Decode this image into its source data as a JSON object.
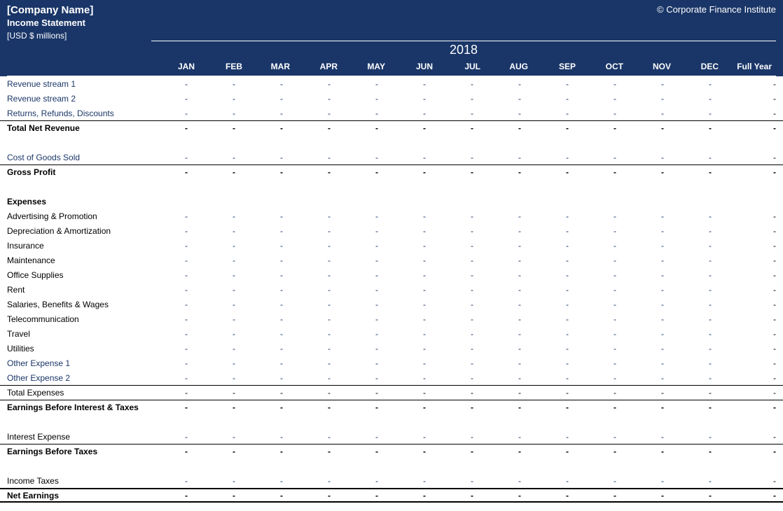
{
  "header": {
    "company_name": "[Company Name]",
    "copyright": "© Corporate Finance Institute",
    "subtitle": "Income Statement",
    "units": "[USD $ millions]",
    "year": "2018",
    "months": [
      "JAN",
      "FEB",
      "MAR",
      "APR",
      "MAY",
      "JUN",
      "JUL",
      "AUG",
      "SEP",
      "OCT",
      "NOV",
      "DEC",
      "Full Year"
    ]
  },
  "rows": [
    {
      "type": "data",
      "label": "Revenue stream 1",
      "labelClass": "input-text",
      "cellClass": "input-val",
      "values": [
        "-",
        "-",
        "-",
        "-",
        "-",
        "-",
        "-",
        "-",
        "-",
        "-",
        "-",
        "-",
        "-"
      ]
    },
    {
      "type": "data",
      "label": "Revenue stream 2",
      "labelClass": "input-text",
      "cellClass": "input-val",
      "values": [
        "-",
        "-",
        "-",
        "-",
        "-",
        "-",
        "-",
        "-",
        "-",
        "-",
        "-",
        "-",
        "-"
      ]
    },
    {
      "type": "data",
      "label": "Returns, Refunds, Discounts",
      "labelClass": "input-text",
      "cellClass": "input-val",
      "values": [
        "-",
        "-",
        "-",
        "-",
        "-",
        "-",
        "-",
        "-",
        "-",
        "-",
        "-",
        "-",
        "-"
      ]
    },
    {
      "type": "data",
      "label": "Total Net Revenue",
      "rowClass": "bold border-top-thin",
      "values": [
        "-",
        "-",
        "-",
        "-",
        "-",
        "-",
        "-",
        "-",
        "-",
        "-",
        "-",
        "-",
        "-"
      ]
    },
    {
      "type": "spacer"
    },
    {
      "type": "data",
      "label": "Cost of Goods Sold",
      "labelClass": "input-text",
      "cellClass": "input-val",
      "values": [
        "-",
        "-",
        "-",
        "-",
        "-",
        "-",
        "-",
        "-",
        "-",
        "-",
        "-",
        "-",
        "-"
      ]
    },
    {
      "type": "data",
      "label": "Gross Profit",
      "rowClass": "bold border-top-thin",
      "values": [
        "-",
        "-",
        "-",
        "-",
        "-",
        "-",
        "-",
        "-",
        "-",
        "-",
        "-",
        "-",
        "-"
      ]
    },
    {
      "type": "spacer"
    },
    {
      "type": "section",
      "label": "Expenses",
      "rowClass": "bold"
    },
    {
      "type": "data",
      "label": "Advertising & Promotion",
      "cellClass": "input-val",
      "values": [
        "-",
        "-",
        "-",
        "-",
        "-",
        "-",
        "-",
        "-",
        "-",
        "-",
        "-",
        "-",
        "-"
      ]
    },
    {
      "type": "data",
      "label": "Depreciation & Amortization",
      "cellClass": "input-val",
      "values": [
        "-",
        "-",
        "-",
        "-",
        "-",
        "-",
        "-",
        "-",
        "-",
        "-",
        "-",
        "-",
        "-"
      ]
    },
    {
      "type": "data",
      "label": "Insurance",
      "cellClass": "input-val",
      "values": [
        "-",
        "-",
        "-",
        "-",
        "-",
        "-",
        "-",
        "-",
        "-",
        "-",
        "-",
        "-",
        "-"
      ]
    },
    {
      "type": "data",
      "label": "Maintenance",
      "cellClass": "input-val",
      "values": [
        "-",
        "-",
        "-",
        "-",
        "-",
        "-",
        "-",
        "-",
        "-",
        "-",
        "-",
        "-",
        "-"
      ]
    },
    {
      "type": "data",
      "label": "Office Supplies",
      "cellClass": "input-val",
      "values": [
        "-",
        "-",
        "-",
        "-",
        "-",
        "-",
        "-",
        "-",
        "-",
        "-",
        "-",
        "-",
        "-"
      ]
    },
    {
      "type": "data",
      "label": "Rent",
      "cellClass": "input-val",
      "values": [
        "-",
        "-",
        "-",
        "-",
        "-",
        "-",
        "-",
        "-",
        "-",
        "-",
        "-",
        "-",
        "-"
      ]
    },
    {
      "type": "data",
      "label": "Salaries, Benefits & Wages",
      "cellClass": "input-val",
      "values": [
        "-",
        "-",
        "-",
        "-",
        "-",
        "-",
        "-",
        "-",
        "-",
        "-",
        "-",
        "-",
        "-"
      ]
    },
    {
      "type": "data",
      "label": "Telecommunication",
      "cellClass": "input-val",
      "values": [
        "-",
        "-",
        "-",
        "-",
        "-",
        "-",
        "-",
        "-",
        "-",
        "-",
        "-",
        "-",
        "-"
      ]
    },
    {
      "type": "data",
      "label": "Travel",
      "cellClass": "input-val",
      "values": [
        "-",
        "-",
        "-",
        "-",
        "-",
        "-",
        "-",
        "-",
        "-",
        "-",
        "-",
        "-",
        "-"
      ]
    },
    {
      "type": "data",
      "label": "Utilities",
      "cellClass": "input-val",
      "values": [
        "-",
        "-",
        "-",
        "-",
        "-",
        "-",
        "-",
        "-",
        "-",
        "-",
        "-",
        "-",
        "-"
      ]
    },
    {
      "type": "data",
      "label": "Other Expense 1",
      "labelClass": "input-text",
      "cellClass": "input-val",
      "values": [
        "-",
        "-",
        "-",
        "-",
        "-",
        "-",
        "-",
        "-",
        "-",
        "-",
        "-",
        "-",
        "-"
      ]
    },
    {
      "type": "data",
      "label": "Other Expense 2",
      "labelClass": "input-text",
      "cellClass": "input-val",
      "values": [
        "-",
        "-",
        "-",
        "-",
        "-",
        "-",
        "-",
        "-",
        "-",
        "-",
        "-",
        "-",
        "-"
      ]
    },
    {
      "type": "data",
      "label": "Total Expenses",
      "rowClass": "border-top-thin",
      "values": [
        "-",
        "-",
        "-",
        "-",
        "-",
        "-",
        "-",
        "-",
        "-",
        "-",
        "-",
        "-",
        "-"
      ]
    },
    {
      "type": "data",
      "label": "Earnings Before Interest & Taxes",
      "rowClass": "bold border-top-thin",
      "values": [
        "-",
        "-",
        "-",
        "-",
        "-",
        "-",
        "-",
        "-",
        "-",
        "-",
        "-",
        "-",
        "-"
      ]
    },
    {
      "type": "spacer"
    },
    {
      "type": "data",
      "label": "Interest Expense",
      "cellClass": "input-val",
      "values": [
        "-",
        "-",
        "-",
        "-",
        "-",
        "-",
        "-",
        "-",
        "-",
        "-",
        "-",
        "-",
        "-"
      ]
    },
    {
      "type": "data",
      "label": "Earnings Before Taxes",
      "rowClass": "bold border-top-thin",
      "values": [
        "-",
        "-",
        "-",
        "-",
        "-",
        "-",
        "-",
        "-",
        "-",
        "-",
        "-",
        "-",
        "-"
      ]
    },
    {
      "type": "spacer"
    },
    {
      "type": "data",
      "label": "Income Taxes",
      "cellClass": "input-val",
      "values": [
        "-",
        "-",
        "-",
        "-",
        "-",
        "-",
        "-",
        "-",
        "-",
        "-",
        "-",
        "-",
        "-"
      ]
    },
    {
      "type": "data",
      "label": "Net Earnings",
      "rowClass": "bold border-top-thick border-bottom-thick",
      "values": [
        "-",
        "-",
        "-",
        "-",
        "-",
        "-",
        "-",
        "-",
        "-",
        "-",
        "-",
        "-",
        "-"
      ]
    }
  ]
}
